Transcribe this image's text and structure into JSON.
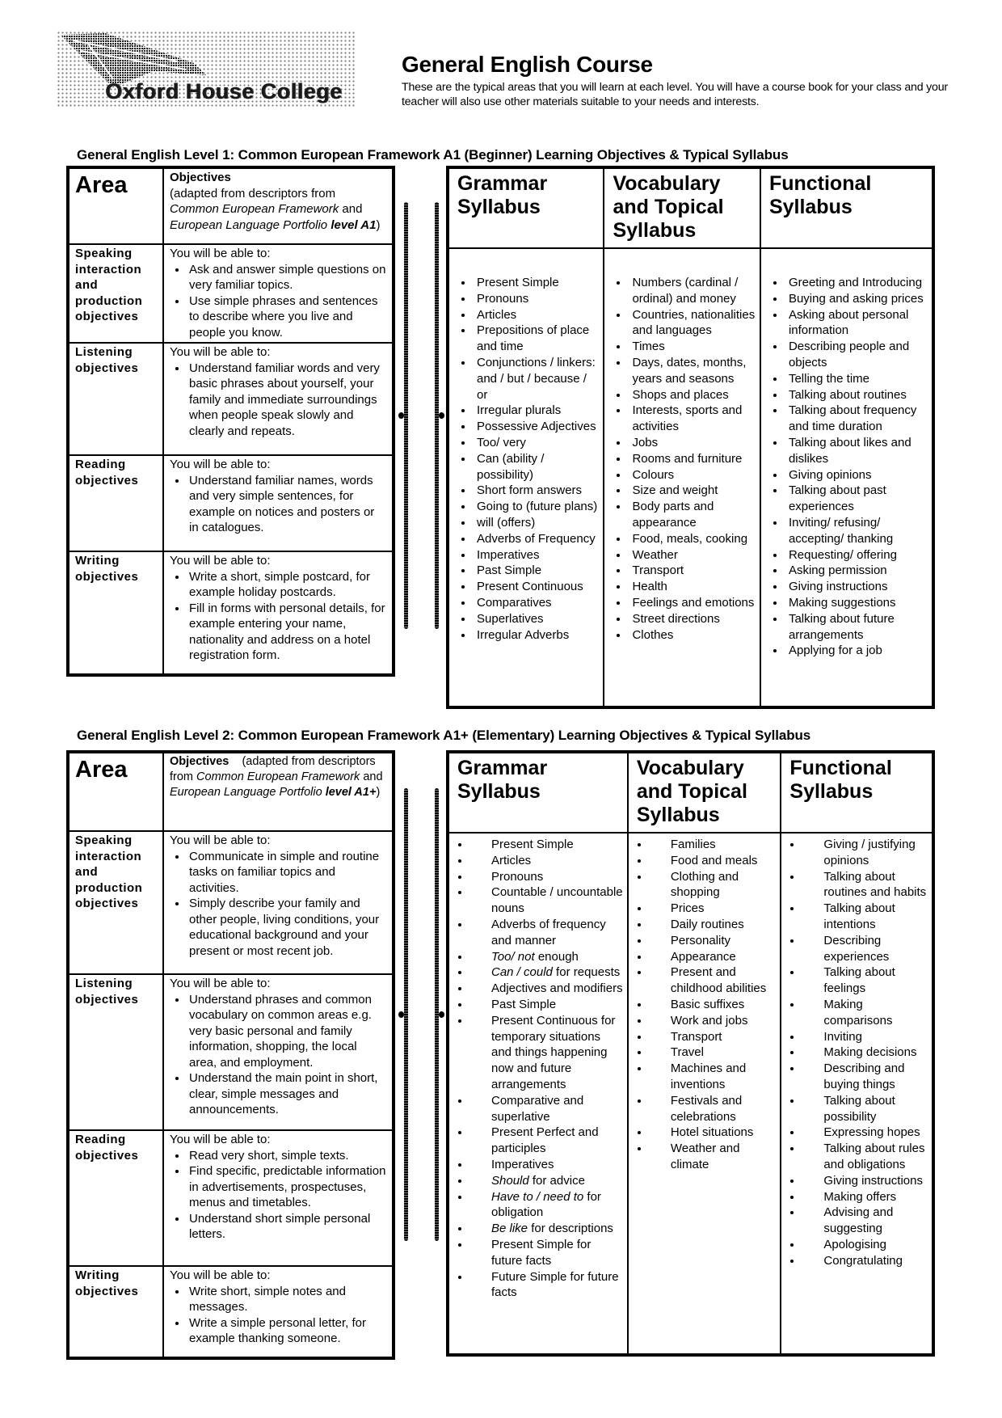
{
  "logo": {
    "text": "Oxford House College"
  },
  "header": {
    "title": "General English Course",
    "intro": "These are the typical areas that you will learn at each level. You will have a course book for your class and your teacher will also use other materials suitable to your needs and interests."
  },
  "levels": [
    {
      "heading_prefix": "General English Level 1:",
      "heading_rest": " Common European Framework A1 (Beginner) Learning Objectives & Typical Syllabus",
      "area_header": "Area",
      "objectives_header": {
        "bold": "Objectives",
        "line1": "(adapted from descriptors from",
        "italic1": "Common European Framework",
        "and": "and",
        "italic2": "European Language Portfolio",
        "bolditalic": "level A1",
        "close": ")"
      },
      "rows": [
        {
          "area": "Speaking interaction and production objectives",
          "intro": "You will be able to:",
          "items": [
            "Ask and answer simple questions on very familiar topics.",
            "Use simple phrases and sentences to describe where you live and people you know."
          ]
        },
        {
          "area": "Listening objectives",
          "intro": "You will be able to:",
          "items": [
            "Understand familiar words and very basic phrases about yourself, your family and immediate surroundings when people speak slowly and clearly and repeats."
          ]
        },
        {
          "area": "Reading objectives",
          "intro": "You will be able to:",
          "items": [
            "Understand familiar names, words and very simple sentences, for example on notices and posters or in catalogues."
          ]
        },
        {
          "area": "Writing objectives",
          "intro": "You will be able to:",
          "items": [
            "Write a short, simple postcard, for example holiday postcards.",
            "Fill in forms with personal details, for example entering your name, nationality and address on a hotel registration form."
          ]
        }
      ],
      "syllabus_headers": [
        "Grammar Syllabus",
        "Vocabulary and Topical Syllabus",
        "Functional Syllabus"
      ],
      "grammar": [
        "Present Simple",
        "Pronouns",
        "Articles",
        "Prepositions of place and time",
        "Conjunctions / linkers: and / but / because / or",
        "Irregular plurals",
        "Possessive Adjectives",
        "Too/ very",
        "Can (ability / possibility)",
        "Short form answers",
        "Going to (future plans)",
        "will (offers)",
        "Adverbs of Frequency",
        "Imperatives",
        "Past Simple",
        "Present Continuous",
        "Comparatives",
        "Superlatives",
        "Irregular Adverbs"
      ],
      "vocabulary": [
        "Numbers (cardinal / ordinal) and money",
        "Countries, nationalities and languages",
        "Times",
        "Days, dates, months, years and seasons",
        "Shops and places",
        "Interests, sports and activities",
        "Jobs",
        "Rooms and furniture",
        "Colours",
        "Size and weight",
        "Body parts and appearance",
        "Food, meals, cooking",
        "Weather",
        "Transport",
        "Health",
        "Feelings and emotions",
        "Street directions",
        "Clothes"
      ],
      "functional": [
        "Greeting and Introducing",
        "Buying and asking prices",
        "Asking about personal information",
        "Describing people and objects",
        "Telling the time",
        "Talking about routines",
        "Talking about frequency and time duration",
        "Talking about likes and dislikes",
        "Giving opinions",
        "Talking about past experiences",
        "Inviting/ refusing/ accepting/ thanking",
        "Requesting/ offering",
        "Asking permission",
        "Giving instructions",
        "Making suggestions",
        "Talking about future arrangements",
        "Applying for a job"
      ]
    },
    {
      "heading_prefix": "General English Level 2:",
      "heading_rest": " Common European Framework A1+ (Elementary) Learning Objectives & Typical Syllabus",
      "area_header": "Area",
      "objectives_header": {
        "bold": "Objectives",
        "line1": "(adapted from descriptors from",
        "italic1": "Common European Framework",
        "and": "and",
        "italic2": "European Language Portfolio",
        "bolditalic": "level A1+",
        "close": ")"
      },
      "rows": [
        {
          "area": "Speaking interaction and production objectives",
          "intro": "You will be able to:",
          "items": [
            "Communicate in simple and routine tasks on familiar topics and activities.",
            "Simply describe your family and other people, living conditions, your educational background and your present or most recent job."
          ]
        },
        {
          "area": "Listening objectives",
          "intro": "You will be able to:",
          "items": [
            "Understand phrases and common vocabulary on common areas e.g. very basic personal and family information, shopping, the local area, and employment.",
            "Understand the main point in short, clear, simple messages and announcements."
          ]
        },
        {
          "area": "Reading objectives",
          "intro": "You will be able to:",
          "items": [
            "Read very short, simple texts.",
            "Find specific, predictable information in advertisements, prospectuses, menus and timetables.",
            "Understand short simple personal letters."
          ]
        },
        {
          "area": "Writing objectives",
          "intro": "You will be able to:",
          "items": [
            "Write short, simple notes and messages.",
            "Write a simple personal letter, for example thanking someone."
          ]
        }
      ],
      "syllabus_headers": [
        "Grammar Syllabus",
        "Vocabulary and Topical Syllabus",
        "Functional Syllabus"
      ],
      "grammar": [
        {
          "text": "Present Simple"
        },
        {
          "text": "Articles"
        },
        {
          "text": "Pronouns"
        },
        {
          "text": "Countable / uncountable nouns"
        },
        {
          "text": "Adverbs of frequency and manner"
        },
        {
          "italic": "Too/ not",
          "text": " enough"
        },
        {
          "italic": "Can / could",
          "text": " for requests"
        },
        {
          "text": "Adjectives and modifiers"
        },
        {
          "text": "Past Simple"
        },
        {
          "text": "Present Continuous for temporary situations and things happening now and future arrangements"
        },
        {
          "text": "Comparative and superlative"
        },
        {
          "text": "Present Perfect and participles"
        },
        {
          "text": "Imperatives"
        },
        {
          "italic": "Should",
          "text": " for advice"
        },
        {
          "italic": "Have to / need to",
          "text": " for obligation"
        },
        {
          "italic": "Be like",
          "text": " for descriptions"
        },
        {
          "text": "Present Simple for future facts"
        },
        {
          "text": "Future Simple for future facts"
        }
      ],
      "vocabulary": [
        "Families",
        "Food and meals",
        "Clothing and shopping",
        "Prices",
        "Daily routines",
        "Personality",
        "Appearance",
        "Present and childhood abilities",
        "Basic suffixes",
        "Work and jobs",
        "Transport",
        "Travel",
        "Machines and inventions",
        "Festivals and celebrations",
        "Hotel situations",
        "Weather and climate"
      ],
      "functional": [
        "Giving / justifying opinions",
        "Talking about routines and habits",
        "Talking about intentions",
        "Describing experiences",
        "Talking about feelings",
        "Making comparisons",
        "Inviting",
        "Making decisions",
        "Describing and buying things",
        "Talking about possibility",
        "Expressing hopes",
        "Talking about rules and obligations",
        "Giving instructions",
        "Making offers",
        "Advising and suggesting",
        "Apologising",
        "Congratulating"
      ]
    }
  ]
}
